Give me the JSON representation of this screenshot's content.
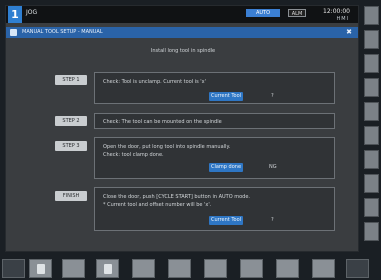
{
  "topbar": {
    "channel": "1",
    "channel_label": "JOG",
    "mode": "AUTO",
    "alarm": "ALM",
    "time": "12:00:00",
    "brand": "HMI"
  },
  "window": {
    "title": "MANUAL TOOL SETUP - MANUAL",
    "close": "✖"
  },
  "main": {
    "heading": "Install long tool in spindle",
    "steps": [
      {
        "label": "STEP 1",
        "lines": [
          "Check: Tool is unclamp. Current tool is 'x'"
        ],
        "button": "Current Tool",
        "status": "?"
      },
      {
        "label": "STEP 2",
        "lines": [
          "Check: The tool can be mounted on the spindle"
        ]
      },
      {
        "label": "STEP 3",
        "lines": [
          "Open the door, put long tool into spindle manually.",
          "Check: tool clamp done."
        ],
        "button": "Clamp done",
        "status": "NG"
      },
      {
        "label": "FINISH",
        "lines": [
          "Close the door, push [CYCLE START] button in AUTO mode.",
          "* Current tool and offset number will be 'x'."
        ],
        "button": "Current Tool",
        "status": "?"
      }
    ]
  }
}
